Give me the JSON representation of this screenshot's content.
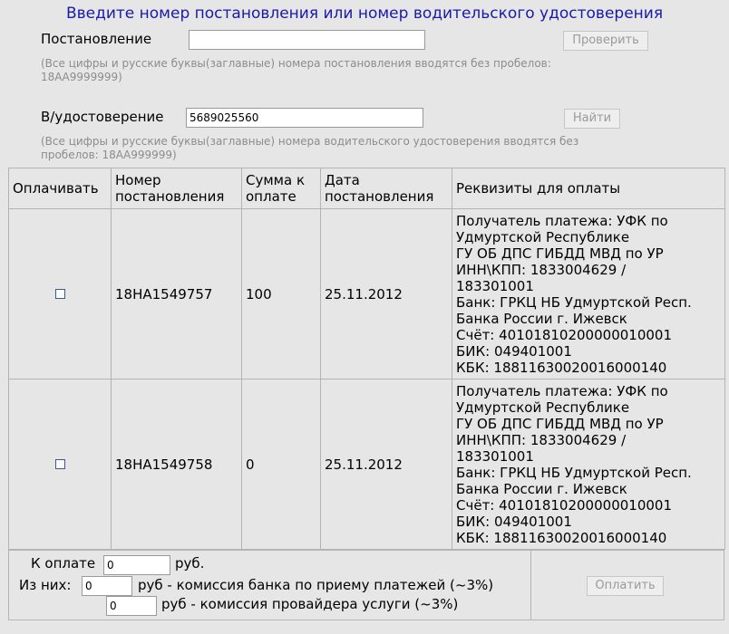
{
  "title": "Введите номер постановления или номер водительского удостоверения",
  "postanovlenie": {
    "label": "Постановление",
    "value": "",
    "button": "Проверить",
    "hint_line1": "(Все цифры и русские буквы(заглавные) номера постановления вводятся без пробелов:",
    "hint_line2": "18АА9999999)"
  },
  "udostoverenie": {
    "label": "В/удостоверение",
    "value": "5689025560",
    "button": "Найти",
    "hint_line1": "(Все цифры и русские буквы(заглавные) номера водительского удостоверения вводятся без",
    "hint_line2": "пробелов: 18АА999999)"
  },
  "table": {
    "headers": {
      "pay": "Оплачивать",
      "number": "Номер постановления",
      "sum": "Сумма к оплате",
      "date": "Дата постановления",
      "rekv": "Реквизиты для оплаты"
    },
    "rows": [
      {
        "checked": false,
        "number": "18НА1549757",
        "sum": "100",
        "date": "25.11.2012",
        "rekv": [
          "Получатель платежа: УФК по",
          "Удмуртской Республике",
          "ГУ ОБ ДПС ГИБДД МВД по УР",
          "ИНН\\КПП: 1833004629 /",
          "183301001",
          "Банк: ГРКЦ НБ Удмуртской Респ.",
          "Банка России г. Ижевск",
          "Счёт: 40101810200000010001",
          "БИК: 049401001",
          "КБК: 18811630020016000140"
        ]
      },
      {
        "checked": false,
        "number": "18НА1549758",
        "sum": "0",
        "date": "25.11.2012",
        "rekv": [
          "Получатель платежа: УФК по",
          "Удмуртской Республике",
          "ГУ ОБ ДПС ГИБДД МВД по УР",
          "ИНН\\КПП: 1833004629 /",
          "183301001",
          "Банк: ГРКЦ НБ Удмуртской Респ.",
          "Банка России г. Ижевск",
          "Счёт: 40101810200000010001",
          "БИК: 049401001",
          "КБК: 18811630020016000140"
        ]
      }
    ]
  },
  "footer": {
    "k_oplate_label": "К оплате",
    "k_oplate_value": "0",
    "rub": "руб.",
    "iz_nih_label": "Из них:",
    "bank_value": "0",
    "bank_text": "руб - комиссия банка по приему платежей (~3%)",
    "provider_value": "0",
    "provider_text": "руб - комиссия провайдера услуги (~3%)",
    "pay_button": "Оплатить"
  }
}
